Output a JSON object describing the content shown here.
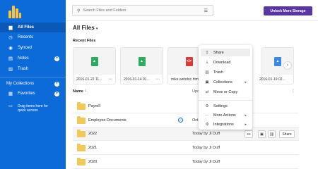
{
  "sidebar": {
    "items": [
      {
        "label": "All Files",
        "icon": "folder-icon"
      },
      {
        "label": "Recents",
        "icon": "clock-icon"
      },
      {
        "label": "Synced",
        "icon": "sync-icon"
      },
      {
        "label": "Notes",
        "icon": "notes-icon"
      },
      {
        "label": "Trash",
        "icon": "trash-icon"
      }
    ],
    "collections_label": "My Collections",
    "favorites_label": "Favorites",
    "drag_hint_line1": "Drag items here for",
    "drag_hint_line2": "quick access"
  },
  "search": {
    "placeholder": "Search Files and Folders"
  },
  "unlock_button": "Unlock More Storage",
  "page_title": "All Files",
  "page_title_caret": "▾",
  "recent": {
    "title": "Recent Files",
    "files": [
      {
        "name": "2016-01-22 11...",
        "type": "image",
        "color": "#2eab5f"
      },
      {
        "name": "2016-01-14 01...",
        "type": "image",
        "color": "#2eab5f"
      },
      {
        "name": "mike.webdoc.htm...",
        "type": "html",
        "color": "#d93a3a"
      },
      {
        "name": "2016-01-19 02...",
        "type": "image",
        "color": "#3c8ae0"
      }
    ]
  },
  "list": {
    "header_name": "Name",
    "header_updated": "Upd",
    "sort_arrow": "↓",
    "header_more": "⋮",
    "rows": [
      {
        "name": "Payroll",
        "updated": ""
      },
      {
        "name": "Employee Documents",
        "updated": "Oct"
      },
      {
        "name": "2022",
        "updated": "Today by Ji Duff"
      },
      {
        "name": "2021",
        "updated": "Today by Ji Duff"
      },
      {
        "name": "2020",
        "updated": "Today by Ji Duff"
      }
    ],
    "share_label": "Share",
    "more_label": "•••"
  },
  "context_menu": {
    "items": [
      {
        "label": "Share",
        "icon": "share-icon"
      },
      {
        "label": "Download",
        "icon": "download-icon"
      },
      {
        "label": "Trash",
        "icon": "trash-icon"
      },
      {
        "label": "Collections",
        "icon": "collections-icon"
      },
      {
        "label": "Move or Copy",
        "icon": "move-icon"
      },
      {
        "label": "Settings",
        "icon": "gear-icon"
      },
      {
        "label": "More Actions",
        "icon": "more-actions-icon"
      },
      {
        "label": "Integrations",
        "icon": "integrations-icon"
      }
    ]
  },
  "colors": {
    "sidebar": "#0d6ad9",
    "accent": "#5a37a0",
    "folder": "#f3c85b"
  }
}
